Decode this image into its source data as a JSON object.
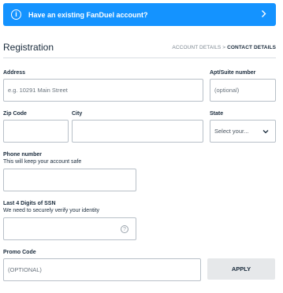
{
  "banner": {
    "icon": "info-icon",
    "text": "Have an existing FanDuel account?",
    "chevron": "chevron-right-icon",
    "bg_color": "#1493ff"
  },
  "header": {
    "title": "Registration",
    "step_1": "ACCOUNT DETAILS",
    "step_sep": ">",
    "step_2": "CONTACT DETAILS"
  },
  "form": {
    "address": {
      "label": "Address",
      "placeholder": "e.g. 10291 Main Street"
    },
    "apt": {
      "label": "Apt/Suite number",
      "placeholder": "(optional)"
    },
    "zip": {
      "label": "Zip Code",
      "value": ""
    },
    "city": {
      "label": "City",
      "value": ""
    },
    "state": {
      "label": "State",
      "selected": "Select your...",
      "icon": "chevron-down-icon"
    },
    "phone": {
      "label": "Phone number",
      "sublabel": "This will keep your account safe",
      "value": ""
    },
    "ssn": {
      "label": "Last 4 Digits of SSN",
      "sublabel": "We need to securely verify your identity",
      "help_icon": "help-icon",
      "help_glyph": "?"
    },
    "promo": {
      "label": "Promo Code",
      "placeholder": "(OPTIONAL)",
      "apply_label": "APPLY"
    }
  }
}
